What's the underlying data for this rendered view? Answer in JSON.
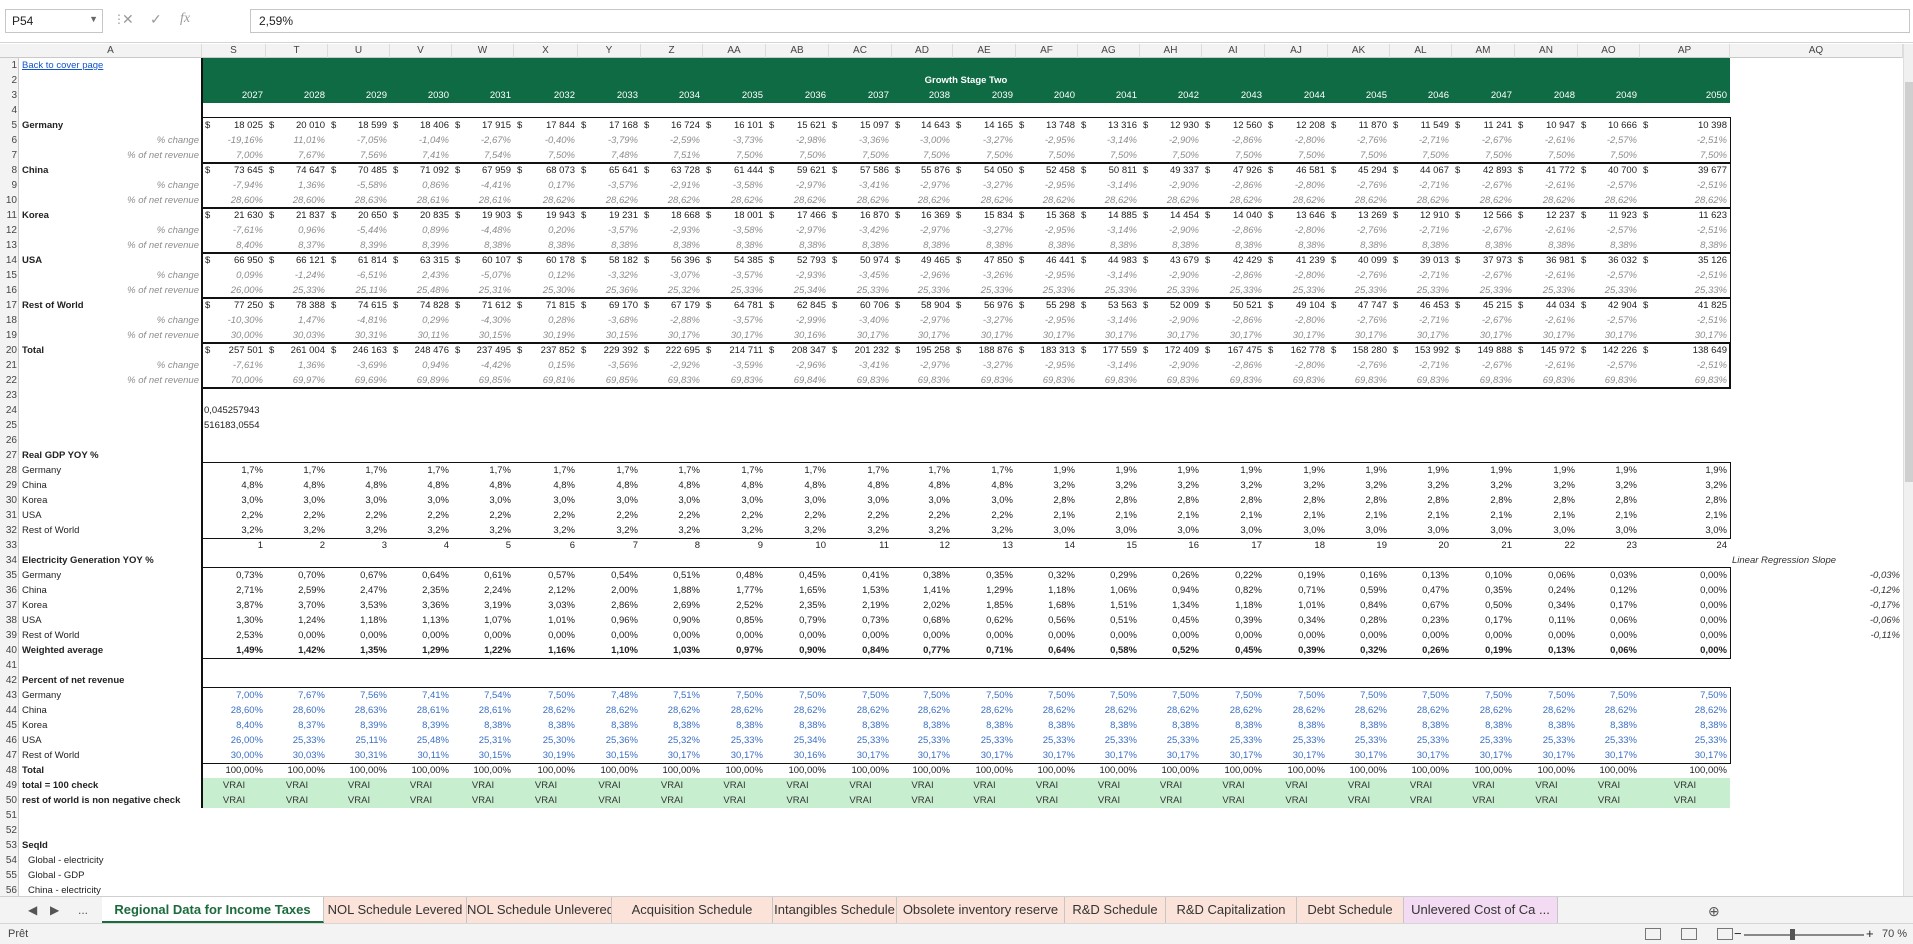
{
  "formula_bar": {
    "name_box": "P54",
    "value": "2,59%",
    "fx": "fx",
    "cancel": "✕",
    "enter": "✓"
  },
  "columns": [
    "A",
    "S",
    "T",
    "U",
    "V",
    "W",
    "X",
    "Y",
    "Z",
    "AA",
    "AB",
    "AC",
    "AD",
    "AE",
    "AF",
    "AG",
    "AH",
    "AI",
    "AJ",
    "AK",
    "AL",
    "AM",
    "AN",
    "AO",
    "AP",
    "AQ"
  ],
  "link": "Back to cover page",
  "banner": "Growth Stage Two",
  "years": [
    "2027",
    "2028",
    "2029",
    "2030",
    "2031",
    "2032",
    "2033",
    "2034",
    "2035",
    "2036",
    "2037",
    "2038",
    "2039",
    "2040",
    "2041",
    "2042",
    "2043",
    "2044",
    "2045",
    "2046",
    "2047",
    "2048",
    "2049",
    "2050"
  ],
  "sub_pct": "% change",
  "sub_rev": "% of net revenue",
  "currency": "$",
  "regions": [
    {
      "name": "Germany",
      "values": [
        "18 025",
        "20 010",
        "18 599",
        "18 406",
        "17 915",
        "17 844",
        "17 168",
        "16 724",
        "16 101",
        "15 621",
        "15 097",
        "14 643",
        "14 165",
        "13 748",
        "13 316",
        "12 930",
        "12 560",
        "12 208",
        "11 870",
        "11 549",
        "11 241",
        "10 947",
        "10 666",
        "10 398"
      ],
      "pct": [
        "-19,16%",
        "11,01%",
        "-7,05%",
        "-1,04%",
        "-2,67%",
        "-0,40%",
        "-3,79%",
        "-2,59%",
        "-3,73%",
        "-2,98%",
        "-3,36%",
        "-3,00%",
        "-3,27%",
        "-2,95%",
        "-3,14%",
        "-2,90%",
        "-2,86%",
        "-2,80%",
        "-2,76%",
        "-2,71%",
        "-2,67%",
        "-2,61%",
        "-2,57%",
        "-2,51%"
      ],
      "rev": [
        "7,00%",
        "7,67%",
        "7,56%",
        "7,41%",
        "7,54%",
        "7,50%",
        "7,48%",
        "7,51%",
        "7,50%",
        "7,50%",
        "7,50%",
        "7,50%",
        "7,50%",
        "7,50%",
        "7,50%",
        "7,50%",
        "7,50%",
        "7,50%",
        "7,50%",
        "7,50%",
        "7,50%",
        "7,50%",
        "7,50%",
        "7,50%"
      ]
    },
    {
      "name": "China",
      "values": [
        "73 645",
        "74 647",
        "70 485",
        "71 092",
        "67 959",
        "68 073",
        "65 641",
        "63 728",
        "61 444",
        "59 621",
        "57 586",
        "55 876",
        "54 050",
        "52 458",
        "50 811",
        "49 337",
        "47 926",
        "46 581",
        "45 294",
        "44 067",
        "42 893",
        "41 772",
        "40 700",
        "39 677"
      ],
      "pct": [
        "-7,94%",
        "1,36%",
        "-5,58%",
        "0,86%",
        "-4,41%",
        "0,17%",
        "-3,57%",
        "-2,91%",
        "-3,58%",
        "-2,97%",
        "-3,41%",
        "-2,97%",
        "-3,27%",
        "-2,95%",
        "-3,14%",
        "-2,90%",
        "-2,86%",
        "-2,80%",
        "-2,76%",
        "-2,71%",
        "-2,67%",
        "-2,61%",
        "-2,57%",
        "-2,51%"
      ],
      "rev": [
        "28,60%",
        "28,60%",
        "28,63%",
        "28,61%",
        "28,61%",
        "28,62%",
        "28,62%",
        "28,62%",
        "28,62%",
        "28,62%",
        "28,62%",
        "28,62%",
        "28,62%",
        "28,62%",
        "28,62%",
        "28,62%",
        "28,62%",
        "28,62%",
        "28,62%",
        "28,62%",
        "28,62%",
        "28,62%",
        "28,62%",
        "28,62%"
      ]
    },
    {
      "name": "Korea",
      "values": [
        "21 630",
        "21 837",
        "20 650",
        "20 835",
        "19 903",
        "19 943",
        "19 231",
        "18 668",
        "18 001",
        "17 466",
        "16 870",
        "16 369",
        "15 834",
        "15 368",
        "14 885",
        "14 454",
        "14 040",
        "13 646",
        "13 269",
        "12 910",
        "12 566",
        "12 237",
        "11 923",
        "11 623"
      ],
      "pct": [
        "-7,61%",
        "0,96%",
        "-5,44%",
        "0,89%",
        "-4,48%",
        "0,20%",
        "-3,57%",
        "-2,93%",
        "-3,58%",
        "-2,97%",
        "-3,42%",
        "-2,97%",
        "-3,27%",
        "-2,95%",
        "-3,14%",
        "-2,90%",
        "-2,86%",
        "-2,80%",
        "-2,76%",
        "-2,71%",
        "-2,67%",
        "-2,61%",
        "-2,57%",
        "-2,51%"
      ],
      "rev": [
        "8,40%",
        "8,37%",
        "8,39%",
        "8,39%",
        "8,38%",
        "8,38%",
        "8,38%",
        "8,38%",
        "8,38%",
        "8,38%",
        "8,38%",
        "8,38%",
        "8,38%",
        "8,38%",
        "8,38%",
        "8,38%",
        "8,38%",
        "8,38%",
        "8,38%",
        "8,38%",
        "8,38%",
        "8,38%",
        "8,38%",
        "8,38%"
      ]
    },
    {
      "name": "USA",
      "values": [
        "66 950",
        "66 121",
        "61 814",
        "63 315",
        "60 107",
        "60 178",
        "58 182",
        "56 396",
        "54 385",
        "52 793",
        "50 974",
        "49 465",
        "47 850",
        "46 441",
        "44 983",
        "43 679",
        "42 429",
        "41 239",
        "40 099",
        "39 013",
        "37 973",
        "36 981",
        "36 032",
        "35 126"
      ],
      "pct": [
        "0,09%",
        "-1,24%",
        "-6,51%",
        "2,43%",
        "-5,07%",
        "0,12%",
        "-3,32%",
        "-3,07%",
        "-3,57%",
        "-2,93%",
        "-3,45%",
        "-2,96%",
        "-3,26%",
        "-2,95%",
        "-3,14%",
        "-2,90%",
        "-2,86%",
        "-2,80%",
        "-2,76%",
        "-2,71%",
        "-2,67%",
        "-2,61%",
        "-2,57%",
        "-2,51%"
      ],
      "rev": [
        "26,00%",
        "25,33%",
        "25,11%",
        "25,48%",
        "25,31%",
        "25,30%",
        "25,36%",
        "25,32%",
        "25,33%",
        "25,34%",
        "25,33%",
        "25,33%",
        "25,33%",
        "25,33%",
        "25,33%",
        "25,33%",
        "25,33%",
        "25,33%",
        "25,33%",
        "25,33%",
        "25,33%",
        "25,33%",
        "25,33%",
        "25,33%"
      ]
    },
    {
      "name": "Rest of World",
      "values": [
        "77 250",
        "78 388",
        "74 615",
        "74 828",
        "71 612",
        "71 815",
        "69 170",
        "67 179",
        "64 781",
        "62 845",
        "60 706",
        "58 904",
        "56 976",
        "55 298",
        "53 563",
        "52 009",
        "50 521",
        "49 104",
        "47 747",
        "46 453",
        "45 215",
        "44 034",
        "42 904",
        "41 825"
      ],
      "pct": [
        "-10,30%",
        "1,47%",
        "-4,81%",
        "0,29%",
        "-4,30%",
        "0,28%",
        "-3,68%",
        "-2,88%",
        "-3,57%",
        "-2,99%",
        "-3,40%",
        "-2,97%",
        "-3,27%",
        "-2,95%",
        "-3,14%",
        "-2,90%",
        "-2,86%",
        "-2,80%",
        "-2,76%",
        "-2,71%",
        "-2,67%",
        "-2,61%",
        "-2,57%",
        "-2,51%"
      ],
      "rev": [
        "30,00%",
        "30,03%",
        "30,31%",
        "30,11%",
        "30,15%",
        "30,19%",
        "30,15%",
        "30,17%",
        "30,17%",
        "30,16%",
        "30,17%",
        "30,17%",
        "30,17%",
        "30,17%",
        "30,17%",
        "30,17%",
        "30,17%",
        "30,17%",
        "30,17%",
        "30,17%",
        "30,17%",
        "30,17%",
        "30,17%",
        "30,17%"
      ]
    },
    {
      "name": "Total",
      "values": [
        "257 501",
        "261 004",
        "246 163",
        "248 476",
        "237 495",
        "237 852",
        "229 392",
        "222 695",
        "214 711",
        "208 347",
        "201 232",
        "195 258",
        "188 876",
        "183 313",
        "177 559",
        "172 409",
        "167 475",
        "162 778",
        "158 280",
        "153 992",
        "149 888",
        "145 972",
        "142 226",
        "138 649"
      ],
      "pct": [
        "-7,61%",
        "1,36%",
        "-3,69%",
        "0,94%",
        "-4,42%",
        "0,15%",
        "-3,56%",
        "-2,92%",
        "-3,59%",
        "-2,96%",
        "-3,41%",
        "-2,97%",
        "-3,27%",
        "-2,95%",
        "-3,14%",
        "-2,90%",
        "-2,86%",
        "-2,80%",
        "-2,76%",
        "-2,71%",
        "-2,67%",
        "-2,61%",
        "-2,57%",
        "-2,51%"
      ],
      "rev": [
        "70,00%",
        "69,97%",
        "69,69%",
        "69,89%",
        "69,85%",
        "69,81%",
        "69,85%",
        "69,83%",
        "69,83%",
        "69,84%",
        "69,83%",
        "69,83%",
        "69,83%",
        "69,83%",
        "69,83%",
        "69,83%",
        "69,83%",
        "69,83%",
        "69,83%",
        "69,83%",
        "69,83%",
        "69,83%",
        "69,83%",
        "69,83%"
      ]
    }
  ],
  "row24": "0,045257943",
  "row25": "516183,0554",
  "gdp": {
    "title": "Real GDP YOY %",
    "rows": [
      {
        "name": "Germany",
        "values": [
          "1,7%",
          "1,7%",
          "1,7%",
          "1,7%",
          "1,7%",
          "1,7%",
          "1,7%",
          "1,7%",
          "1,7%",
          "1,7%",
          "1,7%",
          "1,7%",
          "1,7%",
          "1,9%",
          "1,9%",
          "1,9%",
          "1,9%",
          "1,9%",
          "1,9%",
          "1,9%",
          "1,9%",
          "1,9%",
          "1,9%",
          "1,9%"
        ]
      },
      {
        "name": "China",
        "values": [
          "4,8%",
          "4,8%",
          "4,8%",
          "4,8%",
          "4,8%",
          "4,8%",
          "4,8%",
          "4,8%",
          "4,8%",
          "4,8%",
          "4,8%",
          "4,8%",
          "4,8%",
          "3,2%",
          "3,2%",
          "3,2%",
          "3,2%",
          "3,2%",
          "3,2%",
          "3,2%",
          "3,2%",
          "3,2%",
          "3,2%",
          "3,2%"
        ]
      },
      {
        "name": "Korea",
        "values": [
          "3,0%",
          "3,0%",
          "3,0%",
          "3,0%",
          "3,0%",
          "3,0%",
          "3,0%",
          "3,0%",
          "3,0%",
          "3,0%",
          "3,0%",
          "3,0%",
          "3,0%",
          "2,8%",
          "2,8%",
          "2,8%",
          "2,8%",
          "2,8%",
          "2,8%",
          "2,8%",
          "2,8%",
          "2,8%",
          "2,8%",
          "2,8%"
        ]
      },
      {
        "name": "USA",
        "values": [
          "2,2%",
          "2,2%",
          "2,2%",
          "2,2%",
          "2,2%",
          "2,2%",
          "2,2%",
          "2,2%",
          "2,2%",
          "2,2%",
          "2,2%",
          "2,2%",
          "2,2%",
          "2,1%",
          "2,1%",
          "2,1%",
          "2,1%",
          "2,1%",
          "2,1%",
          "2,1%",
          "2,1%",
          "2,1%",
          "2,1%",
          "2,1%"
        ]
      },
      {
        "name": "Rest of World",
        "values": [
          "3,2%",
          "3,2%",
          "3,2%",
          "3,2%",
          "3,2%",
          "3,2%",
          "3,2%",
          "3,2%",
          "3,2%",
          "3,2%",
          "3,2%",
          "3,2%",
          "3,2%",
          "3,0%",
          "3,0%",
          "3,0%",
          "3,0%",
          "3,0%",
          "3,0%",
          "3,0%",
          "3,0%",
          "3,0%",
          "3,0%",
          "3,0%"
        ]
      }
    ]
  },
  "index_row": [
    "1",
    "2",
    "3",
    "4",
    "5",
    "6",
    "7",
    "8",
    "9",
    "10",
    "11",
    "12",
    "13",
    "14",
    "15",
    "16",
    "17",
    "18",
    "19",
    "20",
    "21",
    "22",
    "23",
    "24"
  ],
  "elec": {
    "title": "Electricity Generation YOY %",
    "slope_label": "Linear Regression Slope",
    "rows": [
      {
        "name": "Germany",
        "values": [
          "0,73%",
          "0,70%",
          "0,67%",
          "0,64%",
          "0,61%",
          "0,57%",
          "0,54%",
          "0,51%",
          "0,48%",
          "0,45%",
          "0,41%",
          "0,38%",
          "0,35%",
          "0,32%",
          "0,29%",
          "0,26%",
          "0,22%",
          "0,19%",
          "0,16%",
          "0,13%",
          "0,10%",
          "0,06%",
          "0,03%",
          "0,00%"
        ],
        "slope": "-0,03%"
      },
      {
        "name": "China",
        "values": [
          "2,71%",
          "2,59%",
          "2,47%",
          "2,35%",
          "2,24%",
          "2,12%",
          "2,00%",
          "1,88%",
          "1,77%",
          "1,65%",
          "1,53%",
          "1,41%",
          "1,29%",
          "1,18%",
          "1,06%",
          "0,94%",
          "0,82%",
          "0,71%",
          "0,59%",
          "0,47%",
          "0,35%",
          "0,24%",
          "0,12%",
          "0,00%"
        ],
        "slope": "-0,12%"
      },
      {
        "name": "Korea",
        "values": [
          "3,87%",
          "3,70%",
          "3,53%",
          "3,36%",
          "3,19%",
          "3,03%",
          "2,86%",
          "2,69%",
          "2,52%",
          "2,35%",
          "2,19%",
          "2,02%",
          "1,85%",
          "1,68%",
          "1,51%",
          "1,34%",
          "1,18%",
          "1,01%",
          "0,84%",
          "0,67%",
          "0,50%",
          "0,34%",
          "0,17%",
          "0,00%"
        ],
        "slope": "-0,17%"
      },
      {
        "name": "USA",
        "values": [
          "1,30%",
          "1,24%",
          "1,18%",
          "1,13%",
          "1,07%",
          "1,01%",
          "0,96%",
          "0,90%",
          "0,85%",
          "0,79%",
          "0,73%",
          "0,68%",
          "0,62%",
          "0,56%",
          "0,51%",
          "0,45%",
          "0,39%",
          "0,34%",
          "0,28%",
          "0,23%",
          "0,17%",
          "0,11%",
          "0,06%",
          "0,00%"
        ],
        "slope": "-0,06%"
      },
      {
        "name": "Rest of World",
        "values": [
          "2,53%",
          "0,00%",
          "0,00%",
          "0,00%",
          "0,00%",
          "0,00%",
          "0,00%",
          "0,00%",
          "0,00%",
          "0,00%",
          "0,00%",
          "0,00%",
          "0,00%",
          "0,00%",
          "0,00%",
          "0,00%",
          "0,00%",
          "0,00%",
          "0,00%",
          "0,00%",
          "0,00%",
          "0,00%",
          "0,00%",
          "0,00%"
        ],
        "slope": "-0,11%"
      },
      {
        "name": "Weighted average",
        "values": [
          "1,49%",
          "1,42%",
          "1,35%",
          "1,29%",
          "1,22%",
          "1,16%",
          "1,10%",
          "1,03%",
          "0,97%",
          "0,90%",
          "0,84%",
          "0,77%",
          "0,71%",
          "0,64%",
          "0,58%",
          "0,52%",
          "0,45%",
          "0,39%",
          "0,32%",
          "0,26%",
          "0,19%",
          "0,13%",
          "0,06%",
          "0,00%"
        ],
        "slope": ""
      }
    ]
  },
  "pnr": {
    "title": "Percent of net revenue",
    "rows": [
      {
        "name": "Germany",
        "values": [
          "7,00%",
          "7,67%",
          "7,56%",
          "7,41%",
          "7,54%",
          "7,50%",
          "7,48%",
          "7,51%",
          "7,50%",
          "7,50%",
          "7,50%",
          "7,50%",
          "7,50%",
          "7,50%",
          "7,50%",
          "7,50%",
          "7,50%",
          "7,50%",
          "7,50%",
          "7,50%",
          "7,50%",
          "7,50%",
          "7,50%",
          "7,50%"
        ]
      },
      {
        "name": "China",
        "values": [
          "28,60%",
          "28,60%",
          "28,63%",
          "28,61%",
          "28,61%",
          "28,62%",
          "28,62%",
          "28,62%",
          "28,62%",
          "28,62%",
          "28,62%",
          "28,62%",
          "28,62%",
          "28,62%",
          "28,62%",
          "28,62%",
          "28,62%",
          "28,62%",
          "28,62%",
          "28,62%",
          "28,62%",
          "28,62%",
          "28,62%",
          "28,62%"
        ]
      },
      {
        "name": "Korea",
        "values": [
          "8,40%",
          "8,37%",
          "8,39%",
          "8,39%",
          "8,38%",
          "8,38%",
          "8,38%",
          "8,38%",
          "8,38%",
          "8,38%",
          "8,38%",
          "8,38%",
          "8,38%",
          "8,38%",
          "8,38%",
          "8,38%",
          "8,38%",
          "8,38%",
          "8,38%",
          "8,38%",
          "8,38%",
          "8,38%",
          "8,38%",
          "8,38%"
        ]
      },
      {
        "name": "USA",
        "values": [
          "26,00%",
          "25,33%",
          "25,11%",
          "25,48%",
          "25,31%",
          "25,30%",
          "25,36%",
          "25,32%",
          "25,33%",
          "25,34%",
          "25,33%",
          "25,33%",
          "25,33%",
          "25,33%",
          "25,33%",
          "25,33%",
          "25,33%",
          "25,33%",
          "25,33%",
          "25,33%",
          "25,33%",
          "25,33%",
          "25,33%",
          "25,33%"
        ]
      },
      {
        "name": "Rest of World",
        "values": [
          "30,00%",
          "30,03%",
          "30,31%",
          "30,11%",
          "30,15%",
          "30,19%",
          "30,15%",
          "30,17%",
          "30,17%",
          "30,16%",
          "30,17%",
          "30,17%",
          "30,17%",
          "30,17%",
          "30,17%",
          "30,17%",
          "30,17%",
          "30,17%",
          "30,17%",
          "30,17%",
          "30,17%",
          "30,17%",
          "30,17%",
          "30,17%"
        ]
      }
    ],
    "total_label": "Total",
    "total_value": "100,00%",
    "check1": "total = 100 check",
    "check2": "rest of world is non negative check",
    "check_value": "VRAI"
  },
  "seqid": {
    "title": "SeqId",
    "items": [
      "Global - electricity",
      "Global - GDP",
      "China - electricity"
    ]
  },
  "tabs": [
    "Regional Data for Income Taxes",
    "NOL Schedule Levered",
    "NOL Schedule Unlevered",
    "Acquisition Schedule",
    "Intangibles Schedule",
    "Obsolete inventory reserve",
    "R&D Schedule",
    "R&D Capitalization",
    "Debt Schedule",
    "Unlevered Cost of Ca ..."
  ],
  "tab_more": "...",
  "status": {
    "ready": "Prêt",
    "zoom": "70 %"
  }
}
